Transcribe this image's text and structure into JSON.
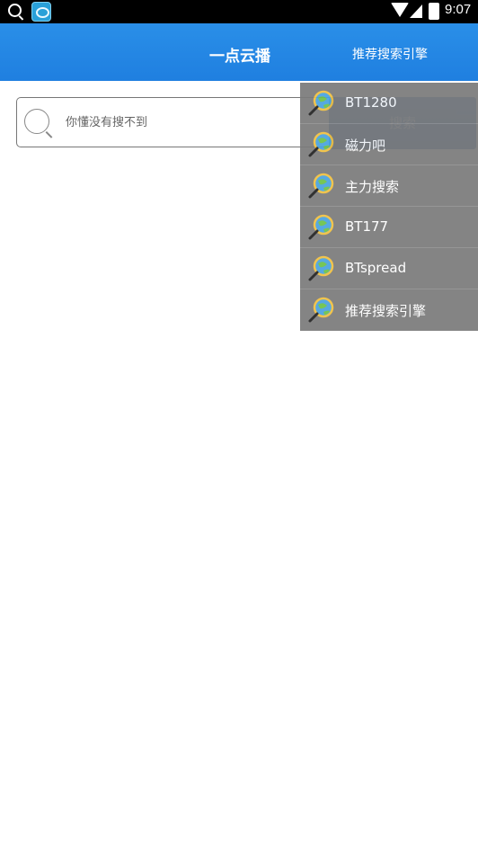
{
  "status_bar": {
    "time": "9:07"
  },
  "app_bar": {
    "title": "一点云播",
    "action": "推荐搜索引擎"
  },
  "search": {
    "placeholder": "你懂没有搜不到",
    "button_label": "搜索"
  },
  "menu": {
    "items": [
      {
        "label": "BT1280",
        "icon": "globe-search-icon"
      },
      {
        "label": "磁力吧",
        "icon": "globe-search-icon"
      },
      {
        "label": "主力搜索",
        "icon": "globe-search-icon"
      },
      {
        "label": "BT177",
        "icon": "globe-search-icon"
      },
      {
        "label": "BTspread",
        "icon": "globe-search-icon"
      },
      {
        "label": "推荐搜索引擎",
        "icon": "globe-search-icon"
      }
    ]
  },
  "colors": {
    "app_bar": "#1f7fe0",
    "menu_bg": "#7b7b7b",
    "search_button": "#2a62b0"
  }
}
